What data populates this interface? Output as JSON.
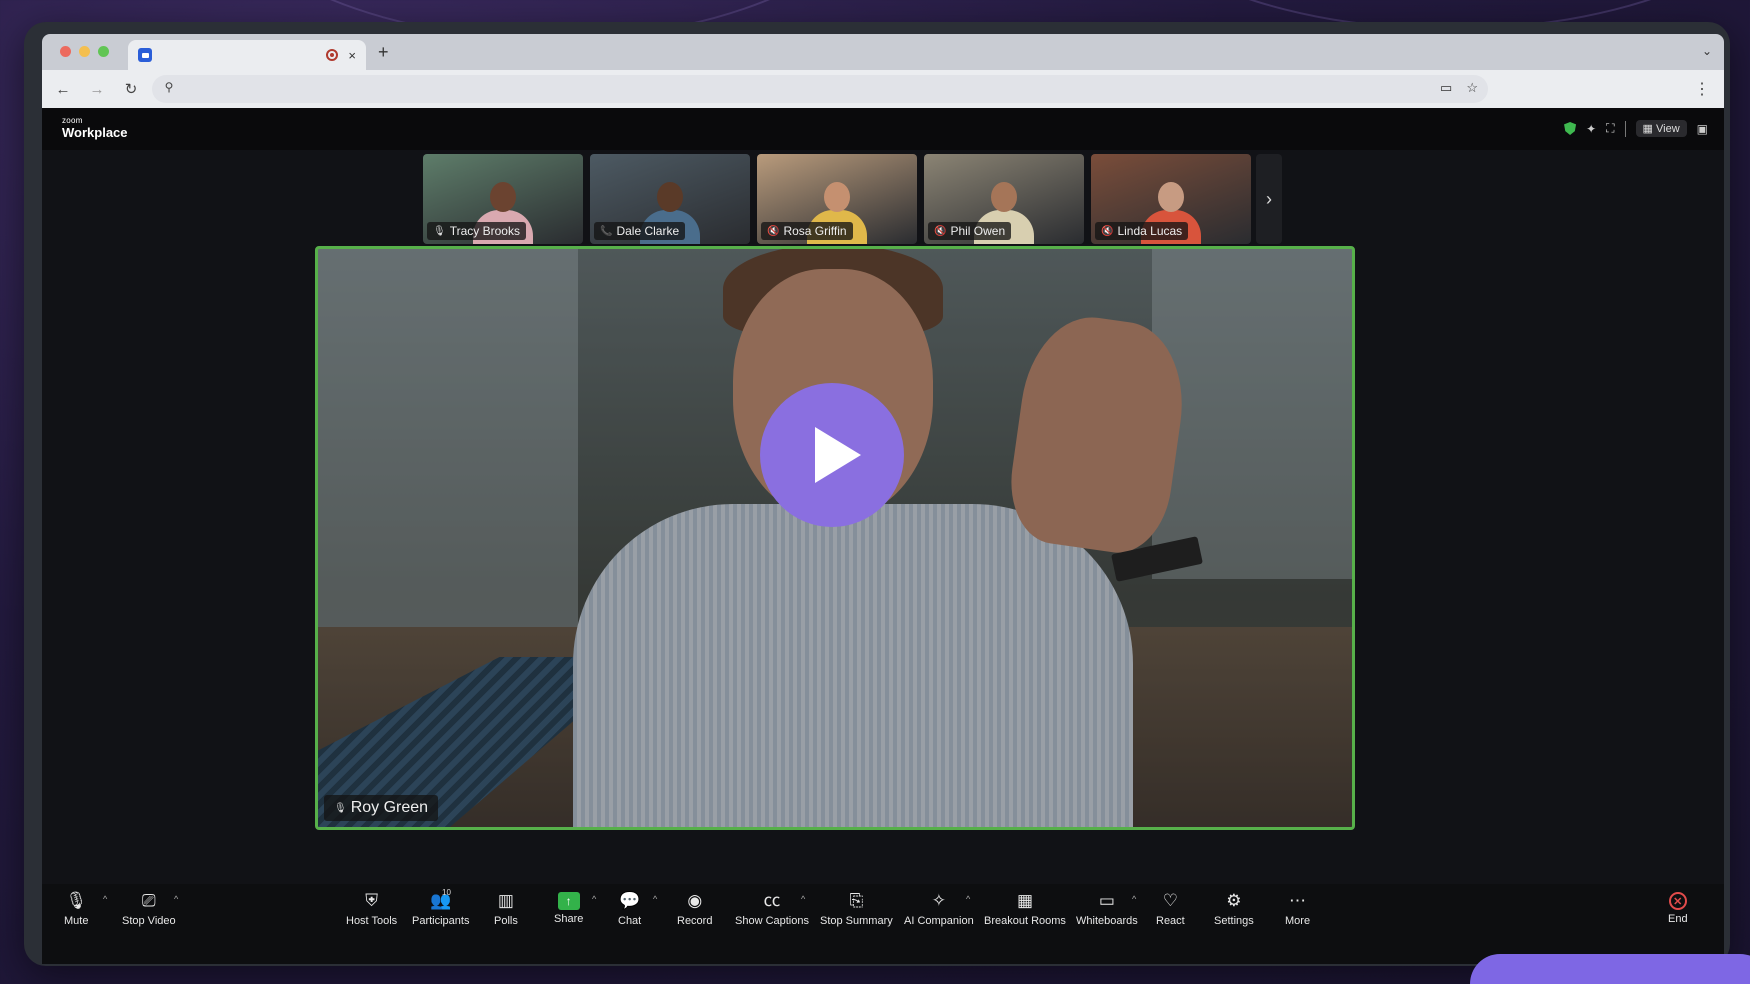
{
  "browser": {
    "tab_close_glyph": "×",
    "new_tab_glyph": "+",
    "tab_menu_glyph": "⌄",
    "nav": {
      "back": "←",
      "forward": "→",
      "reload": "↻",
      "site_info": "⚲"
    },
    "omnibox_icons": {
      "camera": "▭",
      "star": "☆"
    },
    "menu_glyph": "⋮",
    "colors": {
      "close": "#ec6a5e",
      "minimize": "#f4bf4f",
      "maximize": "#61c554"
    }
  },
  "header": {
    "logo_small": "zoom",
    "logo_big": "Workplace",
    "view_label": "View",
    "view_glyph": "▦",
    "icons": {
      "sparkle": "✦",
      "fullscreen": "⛶",
      "pip": "▣"
    }
  },
  "participants": [
    {
      "name": "Tracy Brooks",
      "mic": "🎙",
      "bg": "#5e7d6a",
      "skin": "#6b4330",
      "top": "#d9a9b0"
    },
    {
      "name": "Dale Clarke",
      "mic": "📞",
      "bg": "#4d5a63",
      "skin": "#5a3a28",
      "top": "#4a6d8c"
    },
    {
      "name": "Rosa Griffin",
      "mic": "🔇",
      "bg": "#b99b7c",
      "skin": "#c59070",
      "top": "#e0b84a"
    },
    {
      "name": "Phil Owen",
      "mic": "🔇",
      "bg": "#8b8474",
      "skin": "#a57558",
      "top": "#d8cfb0"
    },
    {
      "name": "Linda Lucas",
      "mic": "🔇",
      "bg": "#7a4d3a",
      "skin": "#c79b82",
      "top": "#d8543c"
    }
  ],
  "thumb_next_glyph": "›",
  "speaker": {
    "name": "Roy Green",
    "mic": "🎙"
  },
  "controls": {
    "mute": {
      "label": "Mute",
      "icon": "🎙"
    },
    "stop_video": {
      "label": "Stop Video",
      "icon": "⎚"
    },
    "host_tools": {
      "label": "Host Tools",
      "icon": "⛨"
    },
    "participants": {
      "label": "Participants",
      "icon": "👥",
      "count": "10"
    },
    "polls": {
      "label": "Polls",
      "icon": "▥"
    },
    "share": {
      "label": "Share",
      "icon": "↑"
    },
    "chat": {
      "label": "Chat",
      "icon": "💬"
    },
    "record": {
      "label": "Record",
      "icon": "◉"
    },
    "show_captions": {
      "label": "Show Captions",
      "icon": "㏄"
    },
    "stop_summary": {
      "label": "Stop Summary",
      "icon": "⎘"
    },
    "ai_companion": {
      "label": "AI Companion",
      "icon": "✧"
    },
    "breakout_rooms": {
      "label": "Breakout Rooms",
      "icon": "▦"
    },
    "whiteboards": {
      "label": "Whiteboards",
      "icon": "▭"
    },
    "react": {
      "label": "React",
      "icon": "♡"
    },
    "settings": {
      "label": "Settings",
      "icon": "⚙"
    },
    "more": {
      "label": "More",
      "icon": "⋯"
    },
    "end": {
      "label": "End",
      "icon": "✕"
    },
    "caret": "^"
  }
}
